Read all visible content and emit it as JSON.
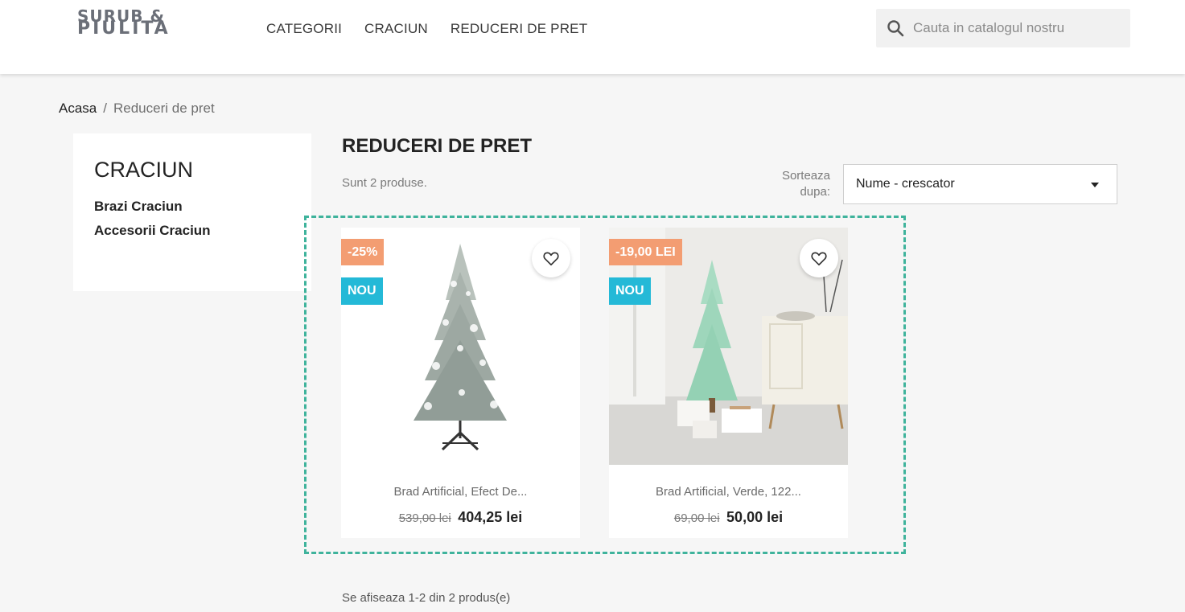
{
  "header": {
    "logo_line1": "SURUB &",
    "logo_line2": "PIULITA",
    "nav": [
      {
        "label": "CATEGORII"
      },
      {
        "label": "CRACIUN"
      },
      {
        "label": "REDUCERI DE PRET"
      }
    ],
    "search_placeholder": "Cauta in catalogul nostru"
  },
  "breadcrumb": {
    "home": "Acasa",
    "separator": "/",
    "current": "Reduceri de pret"
  },
  "sidebar": {
    "title": "CRACIUN",
    "links": [
      {
        "label": "Brazi Craciun"
      },
      {
        "label": "Accesorii Craciun"
      }
    ]
  },
  "main": {
    "title": "REDUCERI DE PRET",
    "count_text": "Sunt 2 produse.",
    "sort_label_line1": "Sorteaza",
    "sort_label_line2": "dupa:",
    "sort_value": "Nume - crescator"
  },
  "products": [
    {
      "discount_badge": "-25%",
      "new_badge": "NOU",
      "name": "Brad Artificial, Efect De...",
      "old_price": "539,00 lei",
      "price": "404,25 lei"
    },
    {
      "discount_badge": "-19,00 LEI",
      "new_badge": "NOU",
      "name": "Brad Artificial, Verde, 122...",
      "old_price": "69,00 lei",
      "price": "50,00 lei"
    }
  ],
  "pagination_text": "Se afiseaza 1-2 din 2 produs(e)",
  "colors": {
    "discount_badge": "#f39d72",
    "new_badge": "#24b9d7",
    "highlight_border": "#3fb39c"
  }
}
